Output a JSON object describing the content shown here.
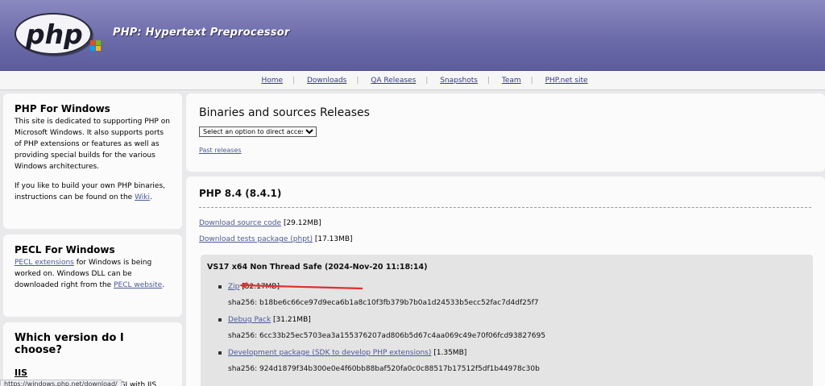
{
  "header": {
    "site_name": "PHP: Hypertext Preprocessor",
    "logo_text": "php"
  },
  "nav": {
    "items": [
      "Home",
      "Downloads",
      "QA Releases",
      "Snapshots",
      "Team",
      "PHP.net site"
    ]
  },
  "sidebar": {
    "windows": {
      "title": "PHP For Windows",
      "text1": "This site is dedicated to supporting PHP on Microsoft Windows. It also supports ports of PHP extensions or features as well as providing special builds for the various Windows architectures.",
      "text2_pre": "If you like to build your own PHP binaries, instructions can be found on the ",
      "text2_link": "Wiki",
      "text2_post": "."
    },
    "pecl": {
      "title": "PECL For Windows",
      "link1": "PECL extensions",
      "text_mid": " for Windows is being worked on. Windows DLL can be downloaded right from the ",
      "link2": "PECL website",
      "text_end": "."
    },
    "which": {
      "title": "Which version do I choose?",
      "subtitle": "IIS",
      "text": "If you are using PHP as FastCGI with IIS"
    }
  },
  "releases": {
    "title": "Binaries and sources Releases",
    "select_value": "Select an option to direct access...",
    "past_releases": "Past releases"
  },
  "php": {
    "version_title": "PHP 8.4 (8.4.1)",
    "source": {
      "label": "Download source code",
      "size": "[29.12MB]"
    },
    "tests": {
      "label": "Download tests package (phpt)",
      "size": "[17.13MB]"
    },
    "build": {
      "title": "VS17 x64 Non Thread Safe (2024-Nov-20 11:18:14)",
      "packages": [
        {
          "label": "Zip",
          "size": "[32.17MB]",
          "sha": "sha256: b18be6c66ce97d9eca6b1a8c10f3fb379b7b0a1d24533b5ecc52fac7d4df25f7"
        },
        {
          "label": "Debug Pack",
          "size": "[31.21MB]",
          "sha": "sha256: 6cc33b25ec5703ea3a155376207ad806b5d67c4aa069c49e70f06fcd93827695"
        },
        {
          "label": "Development package (SDK to develop PHP extensions)",
          "size": "[1.35MB]",
          "sha": "sha256: 924d1879f34b300e0e4f60bb88baf520fa0c0c88517b17512f5df1b44978c30b"
        }
      ]
    }
  },
  "status_bar": {
    "url": "https://windows.php.net/download/"
  },
  "colors": {
    "header": "#6a69a8",
    "link": "#4a5a9c",
    "annotation": "#e0302c"
  },
  "icons": {
    "logo": "php-logo-icon"
  }
}
